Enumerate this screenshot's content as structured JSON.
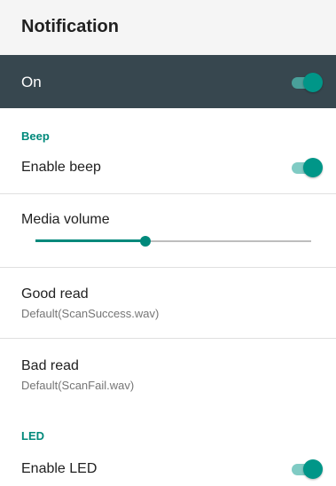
{
  "header": {
    "title": "Notification"
  },
  "master_switch": {
    "label": "On",
    "checked": true
  },
  "beep": {
    "section_label": "Beep",
    "enable_beep": {
      "label": "Enable beep",
      "checked": true
    },
    "media_volume": {
      "label": "Media volume",
      "level_percent": 40
    },
    "good_read": {
      "label": "Good read",
      "value": "Default(ScanSuccess.wav)"
    },
    "bad_read": {
      "label": "Bad read",
      "value": "Default(ScanFail.wav)"
    }
  },
  "led": {
    "section_label": "LED",
    "enable_led": {
      "label": "Enable LED",
      "checked": true
    }
  },
  "colors": {
    "accent": "#009688",
    "master_bar": "#37474f",
    "section_header": "#00897b"
  }
}
